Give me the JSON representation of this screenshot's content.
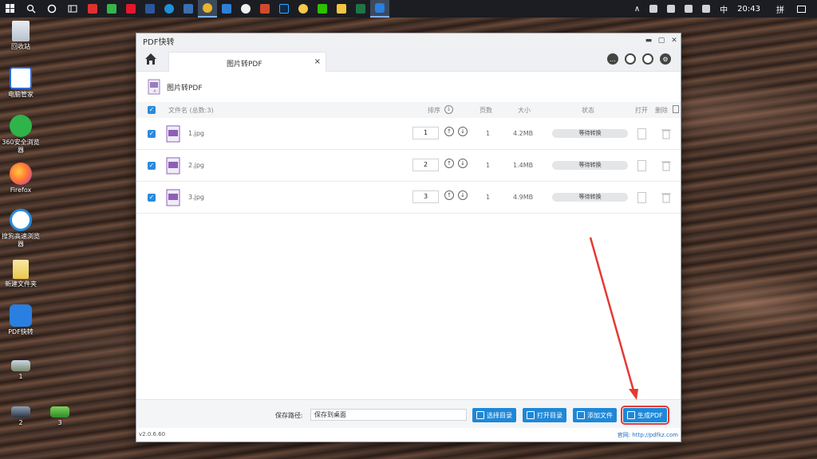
{
  "taskbar": {
    "clock": "20:43",
    "ime": "中",
    "ime_mode": "拼"
  },
  "desktop": {
    "icons": [
      {
        "label": "回收站"
      },
      {
        "label": "电脑管家"
      },
      {
        "label": "360安全浏览器"
      },
      {
        "label": "Firefox"
      },
      {
        "label": "搜狗高速浏览器"
      },
      {
        "label": "新建文件夹"
      },
      {
        "label": "PDF快转"
      },
      {
        "label": "1"
      },
      {
        "label": "2"
      },
      {
        "label": "3"
      }
    ]
  },
  "window": {
    "title": "PDF快转",
    "tab_label": "图片转PDF",
    "tab_close": "×",
    "section_title": "图片转PDF",
    "header": {
      "filename": "文件名 (总数:3)",
      "order": "排序",
      "pages": "页数",
      "size": "大小",
      "status": "状态",
      "open": "打开",
      "delete": "删除"
    },
    "files": [
      {
        "name": "1.jpg",
        "order": "1",
        "pages": "1",
        "size": "4.2MB",
        "status": "等待转换"
      },
      {
        "name": "2.jpg",
        "order": "2",
        "pages": "1",
        "size": "1.4MB",
        "status": "等待转换"
      },
      {
        "name": "3.jpg",
        "order": "3",
        "pages": "1",
        "size": "4.9MB",
        "status": "等待转换"
      }
    ],
    "bottom": {
      "save_label": "保存路径:",
      "save_value": "保存到桌面",
      "select_dir": "选择目录",
      "open_dir": "打开目录",
      "add_file": "添加文件",
      "generate": "生成PDF"
    },
    "footer": {
      "version": "v2.0.6.60",
      "site": "官网: http://pdfkz.com"
    }
  },
  "colors": {
    "accent": "#1e88d8",
    "checkbox": "#2a8bdc",
    "annotation": "#e53935",
    "file_icon": "#8e5fb8"
  }
}
